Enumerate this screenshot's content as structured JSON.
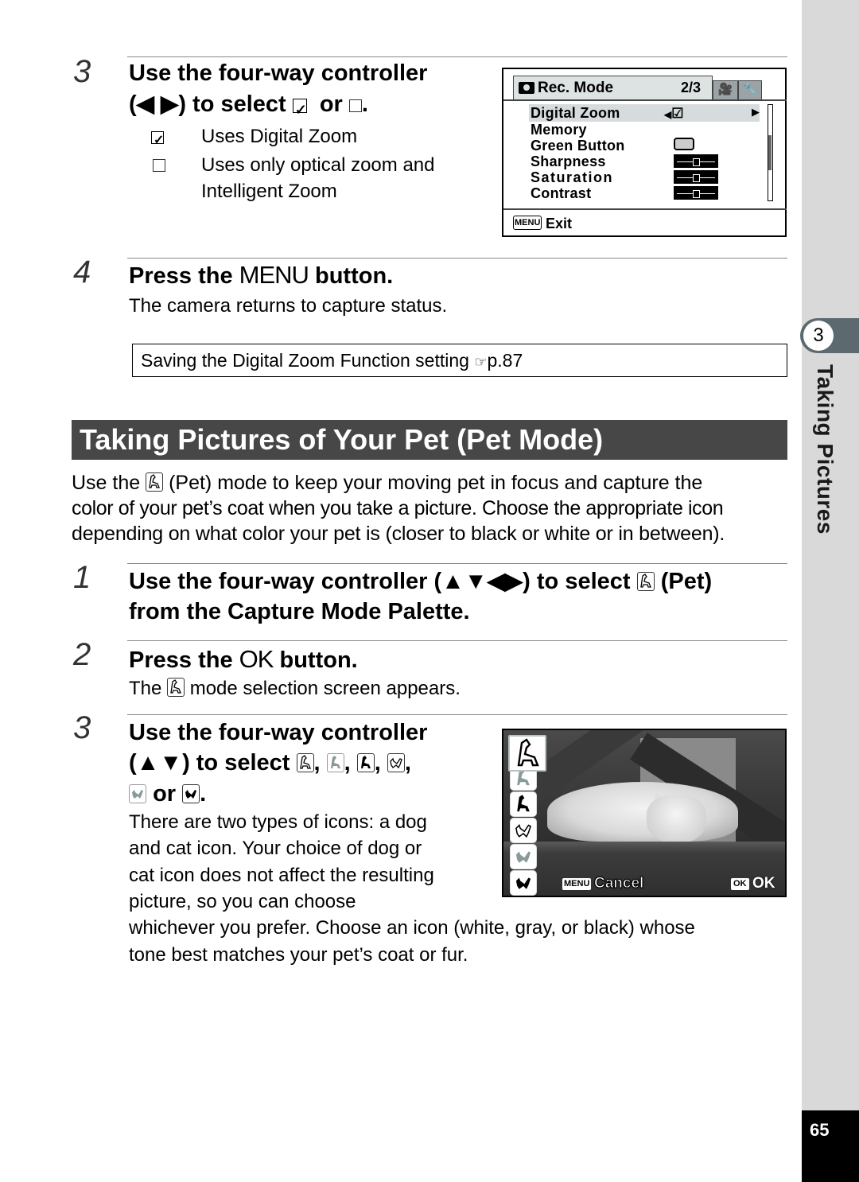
{
  "side_tab": {
    "chapter_number": "3",
    "chapter_title": "Taking Pictures",
    "page_number": "65"
  },
  "digital_zoom_step": {
    "number": "3",
    "heading_line1": "Use the four-way controller",
    "heading_line2_prefix": "(◀ ▶) to select",
    "heading_or": "or",
    "heading_end": ".",
    "options": [
      {
        "icon": "checked-box-icon",
        "text": "Uses Digital Zoom"
      },
      {
        "icon": "empty-box-icon",
        "text_line1": "Uses only optical zoom and",
        "text_line2": "Intelligent Zoom"
      }
    ]
  },
  "rec_mode_screen": {
    "title": "Rec. Mode",
    "page": "2/3",
    "items": [
      {
        "label": "Digital Zoom",
        "value": "☑",
        "selected": true
      },
      {
        "label": "Memory",
        "value": ""
      },
      {
        "label": "Green Button",
        "value": "green-button-indicator"
      },
      {
        "label": "Sharpness",
        "value": "slider-center"
      },
      {
        "label": "Saturation",
        "value": "slider-center"
      },
      {
        "label": "Contrast",
        "value": "slider-center"
      }
    ],
    "footer_badge": "MENU",
    "footer_label": "Exit"
  },
  "menu_step": {
    "number": "4",
    "heading_prefix": "Press the",
    "heading_key": "MENU",
    "heading_suffix": "button.",
    "body": "The camera returns to capture status."
  },
  "note": {
    "text": "Saving the Digital Zoom Function setting",
    "ref_icon": "☞",
    "ref_page": "p.87"
  },
  "section": {
    "title": "Taking Pictures of Your Pet (Pet Mode)",
    "intro_line1_a": "Use the",
    "intro_line1_b": "(Pet) mode to keep your moving pet in focus and capture the",
    "intro_line2": "color of your pet’s coat when you take a picture. Choose the appropriate icon",
    "intro_line3": "depending on what color your pet is (closer to black or white or in between)."
  },
  "pet_steps": [
    {
      "number": "1",
      "line1_a": "Use the four-way controller (▲▼◀▶) to select",
      "line1_b": "(Pet)",
      "line2": "from the Capture Mode Palette."
    },
    {
      "number": "2",
      "heading_prefix": "Press the",
      "heading_key": "OK",
      "heading_suffix": "button.",
      "body_a": "The",
      "body_b": "mode selection screen appears."
    },
    {
      "number": "3",
      "line1": "Use the four-way controller",
      "line2_prefix": "(▲▼) to select",
      "comma": ",",
      "or": "or",
      "period": ".",
      "body_lines": [
        "There are two types of icons: a dog",
        "and cat icon. Your choice of dog or",
        "cat icon does not affect the resulting",
        "picture, so you can choose",
        "whichever you prefer. Choose an icon (white, gray, or black) whose",
        "tone best matches your pet’s coat or fur."
      ]
    }
  ],
  "pet_screen": {
    "icons": [
      "dog-white-icon",
      "dog-gray-icon",
      "dog-black-icon",
      "cat-white-icon",
      "cat-gray-icon",
      "cat-black-icon"
    ],
    "selected_index": 0,
    "cancel_badge": "MENU",
    "cancel_label": "Cancel",
    "ok_badge": "OK",
    "ok_label": "OK"
  },
  "colors": {
    "banner_bg": "#474747",
    "side_strip": "#d9d9d9",
    "chapter_tab": "#5c6a70",
    "page_num_bg": "#000000"
  }
}
